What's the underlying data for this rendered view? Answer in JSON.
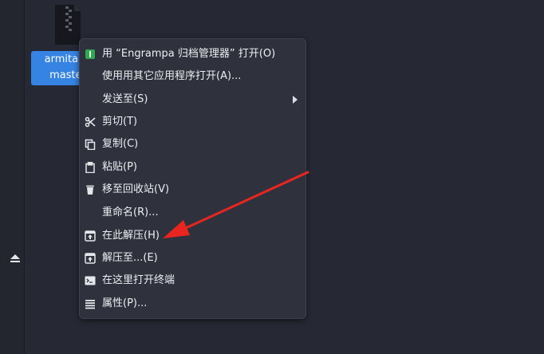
{
  "desktop": {
    "file": {
      "icon": "archive-file-icon",
      "label_line1": "armitage",
      "label_line2": "master"
    }
  },
  "sidebar": {
    "eject_icon": "eject-icon"
  },
  "context_menu": {
    "items": [
      {
        "label": "用 “Engrampa 归档管理器” 打开(O)",
        "icon": "engrampa-app-icon"
      },
      {
        "label": "使用用其它应用程序打开(A)...",
        "icon": ""
      },
      {
        "label": "发送至(S)",
        "icon": "",
        "submenu": true
      },
      {
        "label": "剪切(T)",
        "icon": "scissors-icon"
      },
      {
        "label": "复制(C)",
        "icon": "copy-icon"
      },
      {
        "label": "粘贴(P)",
        "icon": "clipboard-icon"
      },
      {
        "label": "移至回收站(V)",
        "icon": "trash-icon"
      },
      {
        "label": "重命名(R)...",
        "icon": ""
      },
      {
        "label": "在此解压(H)",
        "icon": "extract-here-icon"
      },
      {
        "label": "解压至...(E)",
        "icon": "extract-to-icon"
      },
      {
        "label": "在这里打开终端",
        "icon": "terminal-icon"
      },
      {
        "label": "属性(P)...",
        "icon": "properties-icon"
      }
    ]
  },
  "colors": {
    "background": "#262934",
    "menu_background": "#2f323d",
    "selection": "#3584e4",
    "annotation_arrow": "#e8251f"
  }
}
